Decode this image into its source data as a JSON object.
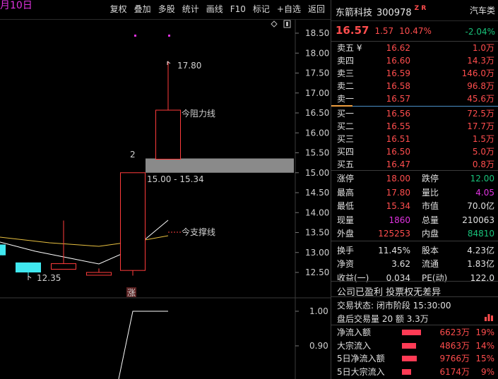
{
  "chart_header": {
    "date_label": "月10日",
    "menu": [
      "复权",
      "叠加",
      "多股",
      "统计",
      "画线",
      "F10",
      "标记",
      "+自选",
      "返回"
    ]
  },
  "chart": {
    "y_axis_labels": [
      "18.50",
      "18.00",
      "17.50",
      "17.00",
      "16.50",
      "16.00",
      "15.50",
      "15.00",
      "14.50",
      "14.00",
      "13.50",
      "13.00",
      "12.50"
    ],
    "sub_y_axis_labels": [
      "1.00",
      "0.90"
    ],
    "high_label": "17.80",
    "low_label": "12.35",
    "resistance_label": "今阻力线",
    "support_label": "今支撑线",
    "zone_label": "15.00 - 15.34",
    "count_label": "2",
    "limit_mark": "涨",
    "colors": {
      "up": "#ff3b3b",
      "down": "#40e8f0",
      "ma": "#e8c040",
      "line": "#ffffff",
      "marker": "#e032e0"
    }
  },
  "chart_data": {
    "type": "candlestick",
    "ylim": [
      12.2,
      18.75
    ],
    "candles": [
      {
        "open": 13.2,
        "close": 12.93,
        "high": 13.2,
        "low": 12.93,
        "dir": "down"
      },
      {
        "open": 12.75,
        "close": 12.5,
        "high": 12.75,
        "low": 12.35,
        "dir": "down"
      },
      {
        "open": 12.58,
        "close": 12.72,
        "high": 13.8,
        "low": 12.58,
        "dir": "up"
      },
      {
        "open": 12.43,
        "close": 12.5,
        "high": 12.6,
        "low": 12.43,
        "dir": "up"
      },
      {
        "open": 12.55,
        "close": 15.0,
        "high": 15.0,
        "low": 12.42,
        "dir": "up"
      },
      {
        "open": 15.34,
        "close": 16.57,
        "high": 17.8,
        "low": 15.34,
        "dir": "up"
      }
    ],
    "zone": [
      15.0,
      15.34
    ],
    "resistance": 16.5,
    "support": 13.55
  },
  "quote": {
    "name": "东箭科技",
    "code": "300978",
    "badge": "Z R",
    "sector": "汽车类",
    "price": "16.57",
    "change": "1.57",
    "pct": "10.47%",
    "sector_change": "-2.04%",
    "asks": [
      {
        "label": "卖五 ¥",
        "price": "16.62",
        "vol": "1.0万"
      },
      {
        "label": "卖四",
        "price": "16.60",
        "vol": "14.3万"
      },
      {
        "label": "卖三",
        "price": "16.59",
        "vol": "146.0万"
      },
      {
        "label": "卖二",
        "price": "16.58",
        "vol": "96.8万"
      },
      {
        "label": "卖一",
        "price": "16.57",
        "vol": "45.6万"
      }
    ],
    "bids": [
      {
        "label": "买一",
        "price": "16.56",
        "vol": "72.5万"
      },
      {
        "label": "买二",
        "price": "16.55",
        "vol": "17.7万"
      },
      {
        "label": "买三",
        "price": "16.51",
        "vol": "1.5万"
      },
      {
        "label": "买四",
        "price": "16.50",
        "vol": "5.0万"
      },
      {
        "label": "买五",
        "price": "16.47",
        "vol": "0.8万"
      }
    ],
    "stats": [
      [
        {
          "label": "涨停",
          "value": "18.00",
          "color": "#ff4d4d"
        },
        {
          "label": "跌停",
          "value": "12.00",
          "color": "#18c27a"
        }
      ],
      [
        {
          "label": "最高",
          "value": "17.80",
          "color": "#ff4d4d"
        },
        {
          "label": "量比",
          "value": "4.05",
          "color": "#e032e0"
        }
      ],
      [
        {
          "label": "最低",
          "value": "15.34",
          "color": "#ff4d4d"
        },
        {
          "label": "市值",
          "value": "70.0亿",
          "color": "#e0e0e0"
        }
      ],
      [
        {
          "label": "现量",
          "value": "1860",
          "color": "#e032e0"
        },
        {
          "label": "总量",
          "value": "210063",
          "color": "#e0e0e0"
        }
      ],
      [
        {
          "label": "外盘",
          "value": "125253",
          "color": "#ff4d4d"
        },
        {
          "label": "内盘",
          "value": "84810",
          "color": "#18c27a"
        }
      ],
      [
        {
          "label": "换手",
          "value": "11.45%",
          "color": "#e0e0e0"
        },
        {
          "label": "股本",
          "value": "4.23亿",
          "color": "#e0e0e0"
        }
      ],
      [
        {
          "label": "净资",
          "value": "3.62",
          "color": "#e0e0e0"
        },
        {
          "label": "流通",
          "value": "1.83亿",
          "color": "#e0e0e0"
        }
      ],
      [
        {
          "label": "收益(一)",
          "value": "0.034",
          "color": "#e0e0e0"
        },
        {
          "label": "PE(动)",
          "value": "122.0",
          "color": "#e0e0e0"
        }
      ]
    ],
    "notice": "公司已盈利 投票权无差异",
    "trade_status": "交易状态: 闭市阶段 15:30:00",
    "after_hours": "盘后交易量 20 额 3.3万",
    "flows": [
      {
        "label": "净流入额",
        "value": "6623万",
        "pct": "19%",
        "bar": 19
      },
      {
        "label": "大宗流入",
        "value": "4863万",
        "pct": "14%",
        "bar": 14
      },
      {
        "label": "5日净流入额",
        "value": "9766万",
        "pct": "15%",
        "bar": 15
      },
      {
        "label": "5日大宗流入",
        "value": "6174万",
        "pct": "9%",
        "bar": 9
      }
    ]
  }
}
